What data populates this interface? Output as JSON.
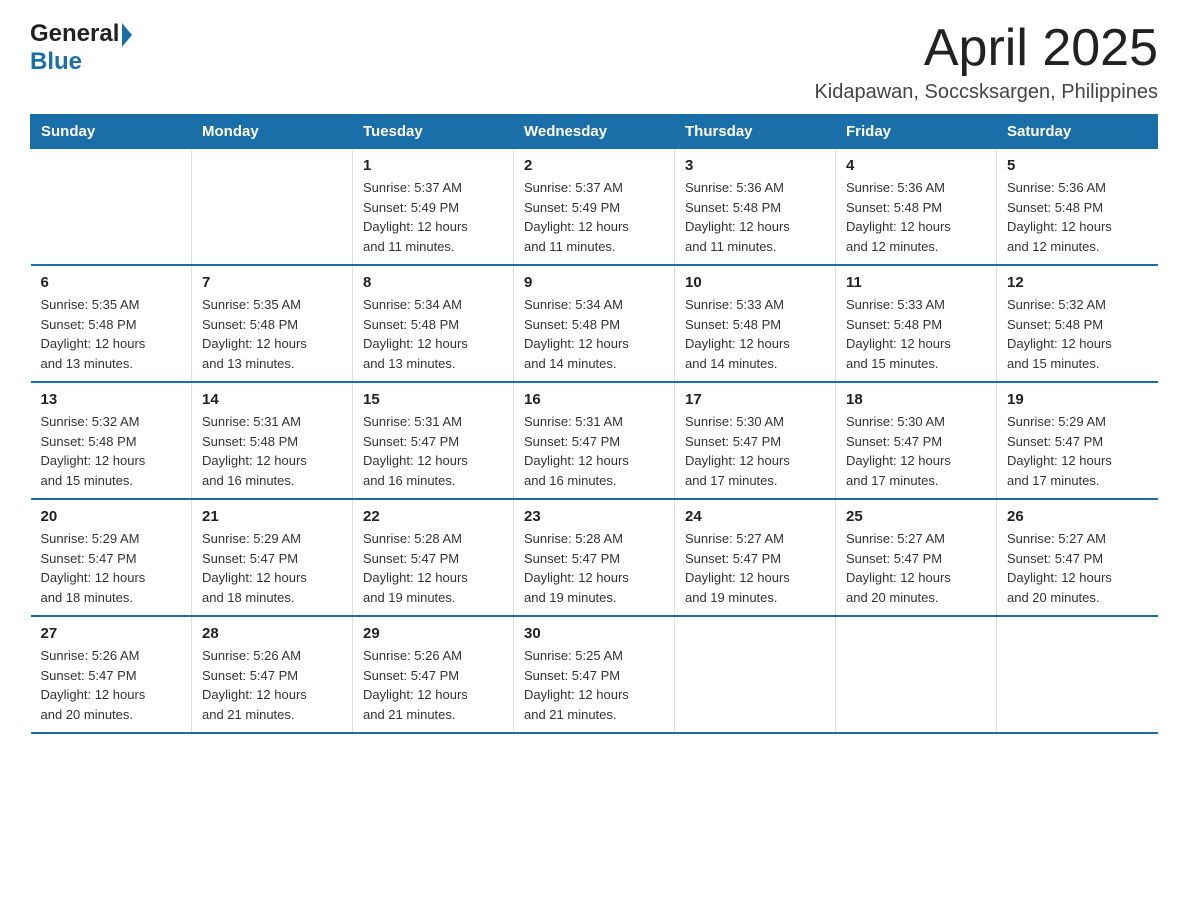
{
  "header": {
    "logo_general": "General",
    "logo_blue": "Blue",
    "title": "April 2025",
    "subtitle": "Kidapawan, Soccsksargen, Philippines"
  },
  "calendar": {
    "days_of_week": [
      "Sunday",
      "Monday",
      "Tuesday",
      "Wednesday",
      "Thursday",
      "Friday",
      "Saturday"
    ],
    "weeks": [
      [
        {
          "day": "",
          "info": ""
        },
        {
          "day": "",
          "info": ""
        },
        {
          "day": "1",
          "info": "Sunrise: 5:37 AM\nSunset: 5:49 PM\nDaylight: 12 hours\nand 11 minutes."
        },
        {
          "day": "2",
          "info": "Sunrise: 5:37 AM\nSunset: 5:49 PM\nDaylight: 12 hours\nand 11 minutes."
        },
        {
          "day": "3",
          "info": "Sunrise: 5:36 AM\nSunset: 5:48 PM\nDaylight: 12 hours\nand 11 minutes."
        },
        {
          "day": "4",
          "info": "Sunrise: 5:36 AM\nSunset: 5:48 PM\nDaylight: 12 hours\nand 12 minutes."
        },
        {
          "day": "5",
          "info": "Sunrise: 5:36 AM\nSunset: 5:48 PM\nDaylight: 12 hours\nand 12 minutes."
        }
      ],
      [
        {
          "day": "6",
          "info": "Sunrise: 5:35 AM\nSunset: 5:48 PM\nDaylight: 12 hours\nand 13 minutes."
        },
        {
          "day": "7",
          "info": "Sunrise: 5:35 AM\nSunset: 5:48 PM\nDaylight: 12 hours\nand 13 minutes."
        },
        {
          "day": "8",
          "info": "Sunrise: 5:34 AM\nSunset: 5:48 PM\nDaylight: 12 hours\nand 13 minutes."
        },
        {
          "day": "9",
          "info": "Sunrise: 5:34 AM\nSunset: 5:48 PM\nDaylight: 12 hours\nand 14 minutes."
        },
        {
          "day": "10",
          "info": "Sunrise: 5:33 AM\nSunset: 5:48 PM\nDaylight: 12 hours\nand 14 minutes."
        },
        {
          "day": "11",
          "info": "Sunrise: 5:33 AM\nSunset: 5:48 PM\nDaylight: 12 hours\nand 15 minutes."
        },
        {
          "day": "12",
          "info": "Sunrise: 5:32 AM\nSunset: 5:48 PM\nDaylight: 12 hours\nand 15 minutes."
        }
      ],
      [
        {
          "day": "13",
          "info": "Sunrise: 5:32 AM\nSunset: 5:48 PM\nDaylight: 12 hours\nand 15 minutes."
        },
        {
          "day": "14",
          "info": "Sunrise: 5:31 AM\nSunset: 5:48 PM\nDaylight: 12 hours\nand 16 minutes."
        },
        {
          "day": "15",
          "info": "Sunrise: 5:31 AM\nSunset: 5:47 PM\nDaylight: 12 hours\nand 16 minutes."
        },
        {
          "day": "16",
          "info": "Sunrise: 5:31 AM\nSunset: 5:47 PM\nDaylight: 12 hours\nand 16 minutes."
        },
        {
          "day": "17",
          "info": "Sunrise: 5:30 AM\nSunset: 5:47 PM\nDaylight: 12 hours\nand 17 minutes."
        },
        {
          "day": "18",
          "info": "Sunrise: 5:30 AM\nSunset: 5:47 PM\nDaylight: 12 hours\nand 17 minutes."
        },
        {
          "day": "19",
          "info": "Sunrise: 5:29 AM\nSunset: 5:47 PM\nDaylight: 12 hours\nand 17 minutes."
        }
      ],
      [
        {
          "day": "20",
          "info": "Sunrise: 5:29 AM\nSunset: 5:47 PM\nDaylight: 12 hours\nand 18 minutes."
        },
        {
          "day": "21",
          "info": "Sunrise: 5:29 AM\nSunset: 5:47 PM\nDaylight: 12 hours\nand 18 minutes."
        },
        {
          "day": "22",
          "info": "Sunrise: 5:28 AM\nSunset: 5:47 PM\nDaylight: 12 hours\nand 19 minutes."
        },
        {
          "day": "23",
          "info": "Sunrise: 5:28 AM\nSunset: 5:47 PM\nDaylight: 12 hours\nand 19 minutes."
        },
        {
          "day": "24",
          "info": "Sunrise: 5:27 AM\nSunset: 5:47 PM\nDaylight: 12 hours\nand 19 minutes."
        },
        {
          "day": "25",
          "info": "Sunrise: 5:27 AM\nSunset: 5:47 PM\nDaylight: 12 hours\nand 20 minutes."
        },
        {
          "day": "26",
          "info": "Sunrise: 5:27 AM\nSunset: 5:47 PM\nDaylight: 12 hours\nand 20 minutes."
        }
      ],
      [
        {
          "day": "27",
          "info": "Sunrise: 5:26 AM\nSunset: 5:47 PM\nDaylight: 12 hours\nand 20 minutes."
        },
        {
          "day": "28",
          "info": "Sunrise: 5:26 AM\nSunset: 5:47 PM\nDaylight: 12 hours\nand 21 minutes."
        },
        {
          "day": "29",
          "info": "Sunrise: 5:26 AM\nSunset: 5:47 PM\nDaylight: 12 hours\nand 21 minutes."
        },
        {
          "day": "30",
          "info": "Sunrise: 5:25 AM\nSunset: 5:47 PM\nDaylight: 12 hours\nand 21 minutes."
        },
        {
          "day": "",
          "info": ""
        },
        {
          "day": "",
          "info": ""
        },
        {
          "day": "",
          "info": ""
        }
      ]
    ]
  }
}
